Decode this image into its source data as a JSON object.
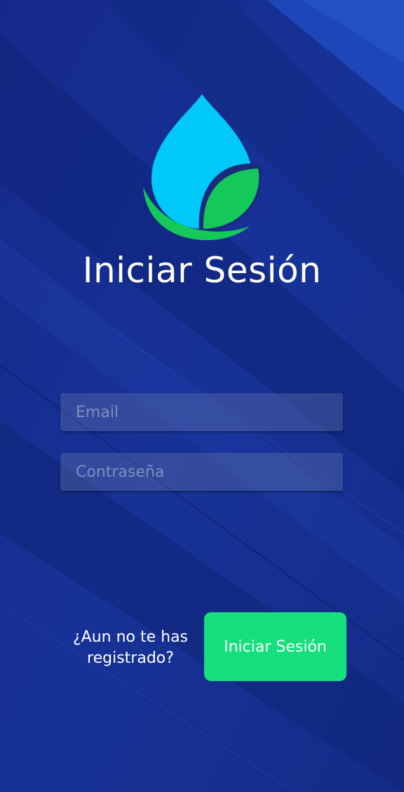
{
  "login": {
    "title": "Iniciar Sesión",
    "email_placeholder": "Email",
    "password_placeholder": "Contraseña",
    "register_prompt": "¿Aun no te has registrado?",
    "submit_label": "Iniciar Sesión"
  },
  "icons": {
    "logo": "water-drop-leaf-logo"
  },
  "colors": {
    "background": "#16318f",
    "drop": "#00c8f8",
    "leaf": "#14c85a",
    "button": "#16e07c",
    "text": "#ffffff"
  }
}
